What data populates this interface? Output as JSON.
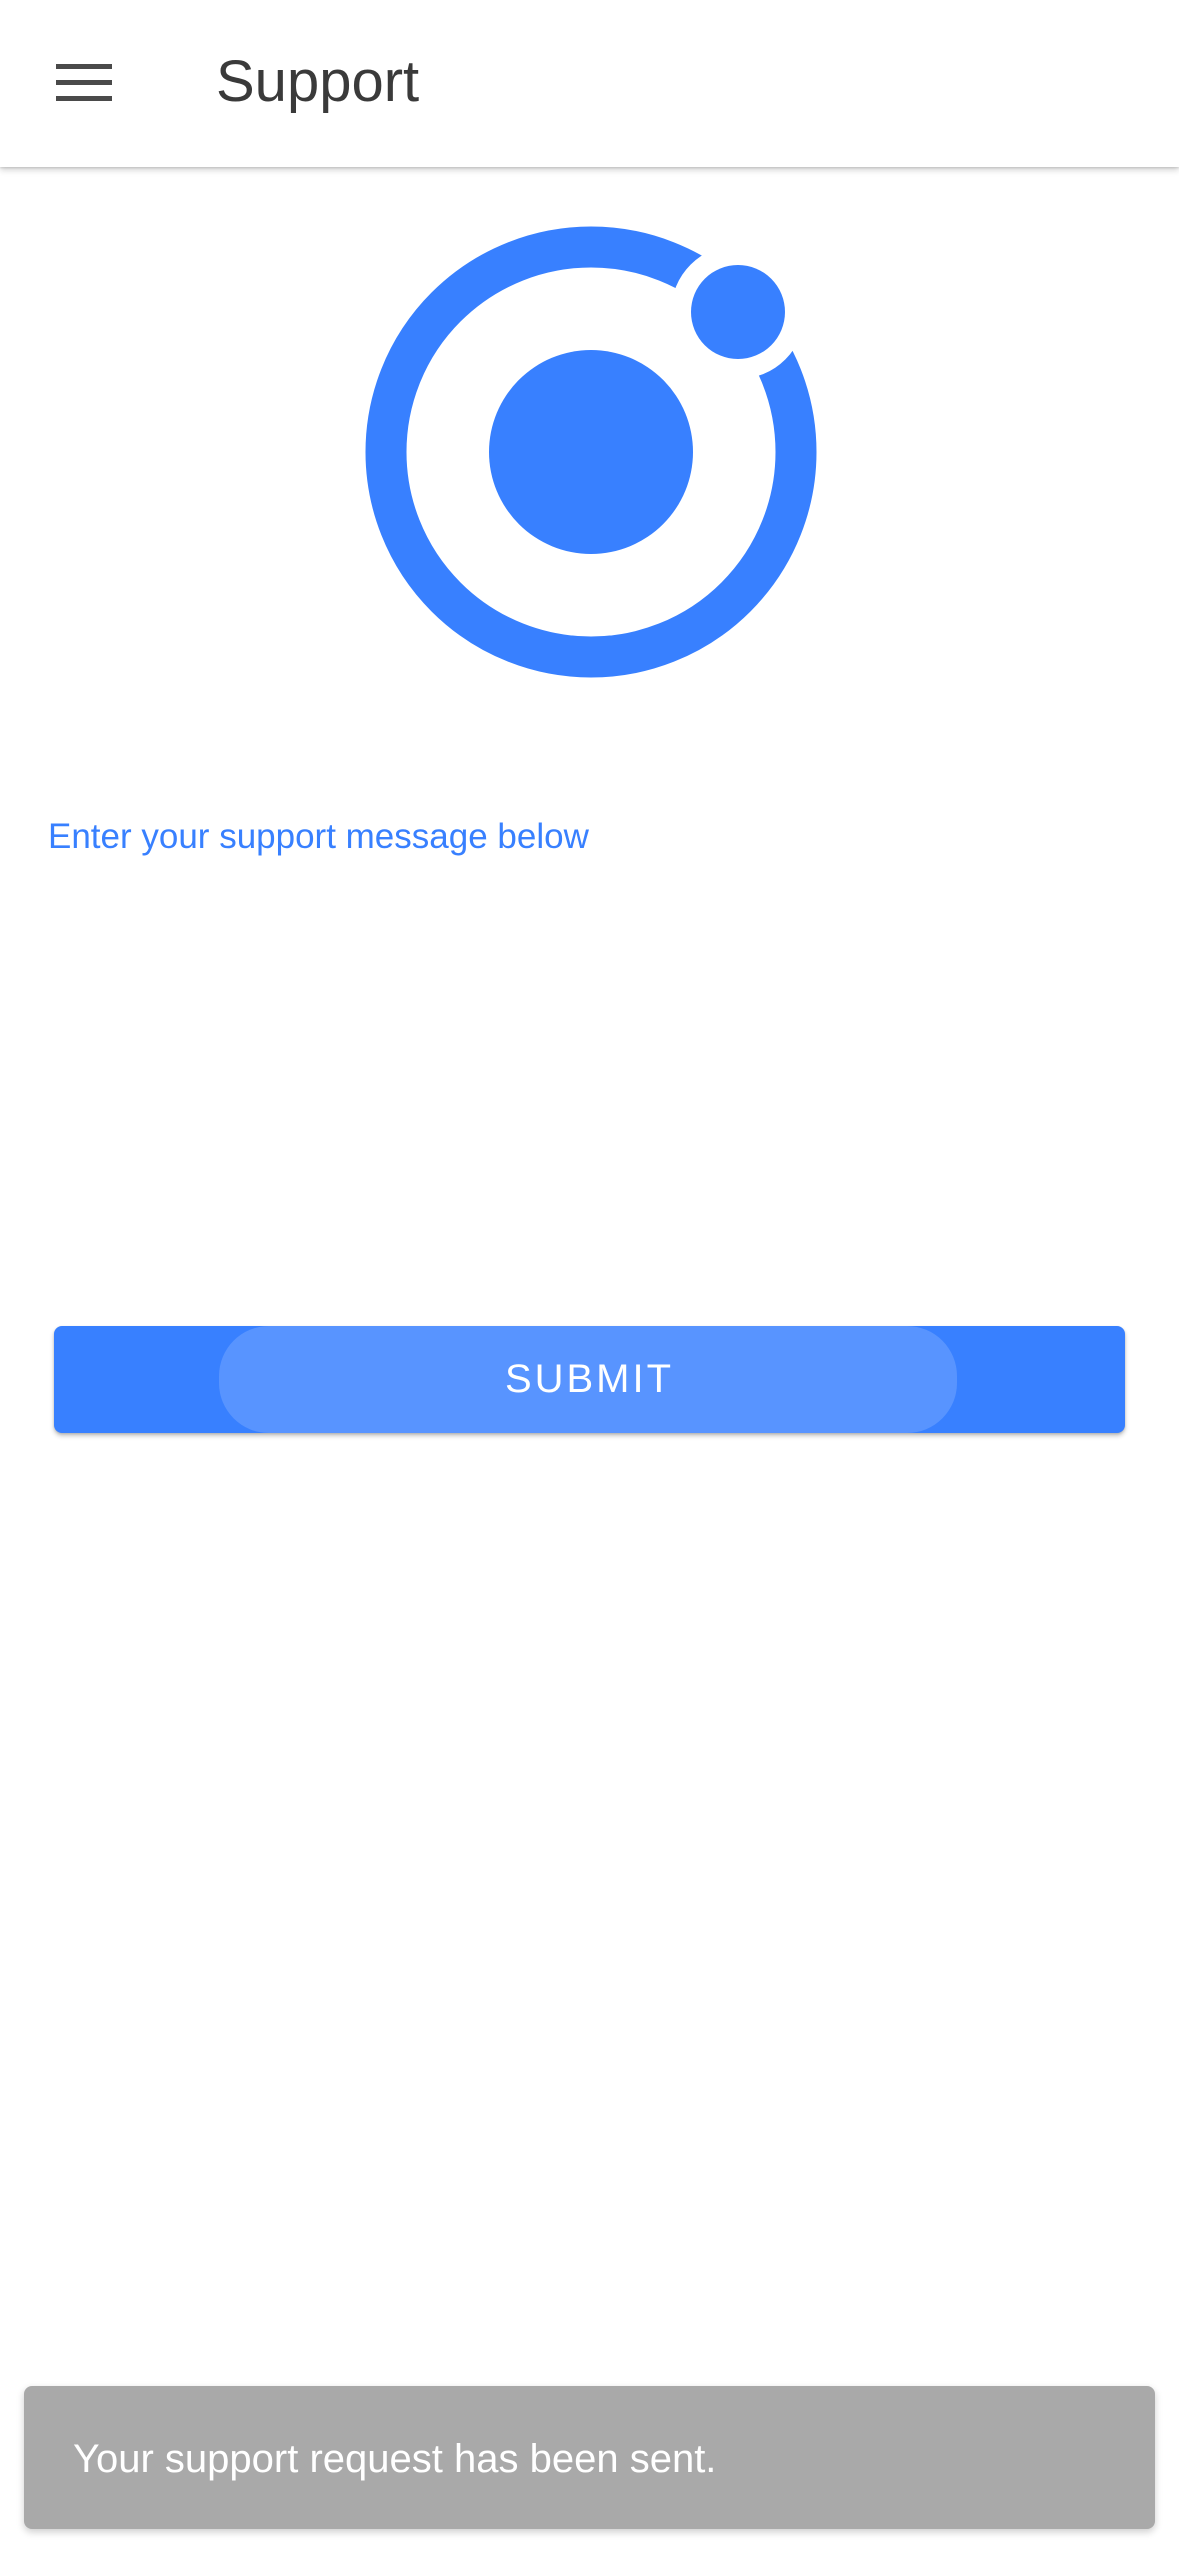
{
  "header": {
    "menu_icon": "menu-icon",
    "title": "Support"
  },
  "logo": {
    "icon": "ionic-logo-icon",
    "color": "#3880ff"
  },
  "form": {
    "message_label": "Enter your support message below",
    "message_value": "",
    "submit_label": "SUBMIT"
  },
  "toast": {
    "message": "Your support request has been sent."
  },
  "colors": {
    "primary": "#3880ff",
    "toast_background": "#a9a9a9",
    "title_text": "#3a3a3a"
  }
}
